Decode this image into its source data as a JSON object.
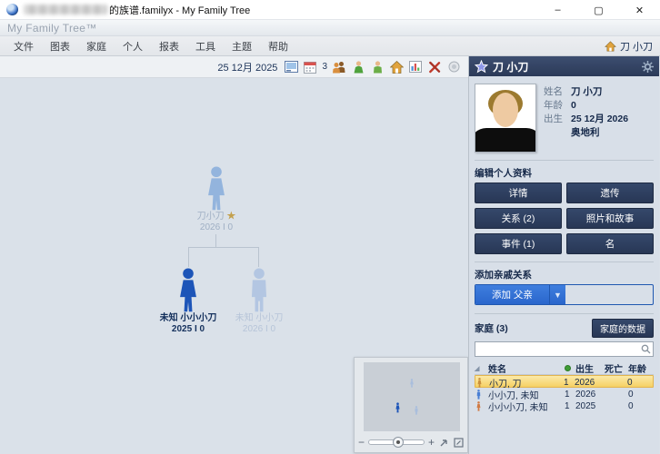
{
  "title_bar": {
    "title": "的族谱.familyx - My Family Tree",
    "minimize": "–",
    "maximize": "▢",
    "close": "✕"
  },
  "brand": {
    "name": "My Family Tree™"
  },
  "menu": {
    "items": [
      "文件",
      "图表",
      "家庭",
      "个人",
      "报表",
      "工具",
      "主题",
      "帮助"
    ],
    "home_person": "刀 小刀"
  },
  "toolbar": {
    "date": "25 12月 2025",
    "count": "3"
  },
  "tree": {
    "root": {
      "name": "刀小刀",
      "star": "★",
      "lifespan": "2026 I 0"
    },
    "children": [
      {
        "name": "未知 小小小刀",
        "lifespan": "2025 I 0"
      },
      {
        "name": "未知 小小刀",
        "lifespan": "2026 I 0"
      }
    ]
  },
  "minimap": {
    "zoom_out": "−",
    "zoom_in": "+"
  },
  "panel": {
    "header": {
      "name": "刀 小刀"
    },
    "details": {
      "name_label": "姓名",
      "name": "刀 小刀",
      "age_label": "年龄",
      "age": "0",
      "born_label": "出生",
      "born": "25 12月 2026",
      "birthplace": "奥地利"
    },
    "edit": {
      "title": "编辑个人资料",
      "buttons": [
        "详情",
        "遗传",
        "关系 (2)",
        "照片和故事",
        "事件 (1)",
        "名"
      ]
    },
    "add": {
      "title": "添加亲戚关系",
      "button": "添加 父亲"
    },
    "family": {
      "title": "家庭 (3)",
      "data_button": "家庭的数据",
      "search_placeholder": "",
      "table": {
        "name_header": "姓名",
        "born_header": "出生",
        "died_header": "死亡",
        "age_header": "年龄",
        "rows": [
          {
            "name": "小刀, 刀",
            "marker": "1",
            "born": "2026",
            "died": "",
            "age": "0"
          },
          {
            "name": "小小刀, 未知",
            "marker": "1",
            "born": "2026",
            "died": "",
            "age": "0"
          },
          {
            "name": "小小小刀, 未知",
            "marker": "1",
            "born": "2025",
            "died": "",
            "age": "0"
          }
        ]
      }
    }
  }
}
